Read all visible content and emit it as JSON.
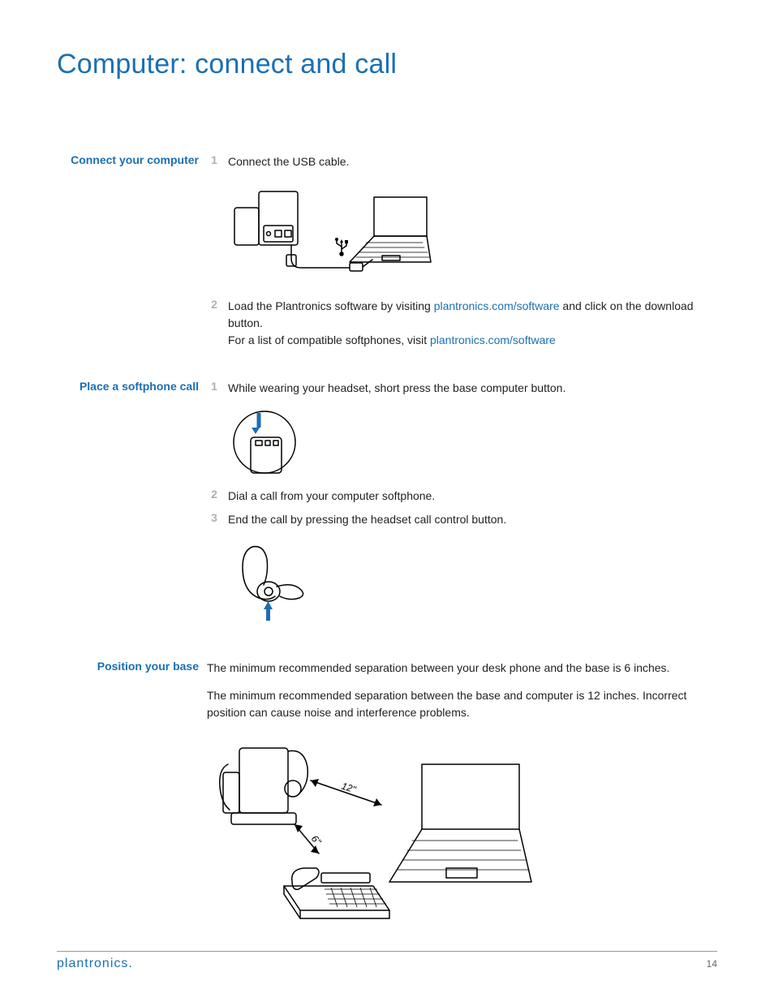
{
  "title": "Computer: connect and call",
  "sections": {
    "connect": {
      "label": "Connect your computer",
      "steps": [
        {
          "num": "1",
          "text": "Connect the USB cable."
        },
        {
          "num": "2",
          "pre": "Load the Plantronics software by visiting ",
          "link1": "plantronics.com/software",
          "mid": " and click on the download button.",
          "line2a": "For a list of compatible softphones, visit ",
          "link2": "plantronics.com/software"
        }
      ]
    },
    "softphone": {
      "label": "Place a softphone call",
      "steps": [
        {
          "num": "1",
          "text": "While wearing your headset, short press the base computer button."
        },
        {
          "num": "2",
          "text": "Dial a call from your computer softphone."
        },
        {
          "num": "3",
          "text": "End the call by pressing the headset call control button."
        }
      ]
    },
    "position": {
      "label": "Position your base",
      "para1": "The minimum recommended separation between your desk phone and the base is 6 inches.",
      "para2": "The minimum recommended separation between the base and computer is 12 inches. Incorrect position can cause noise and interference problems.",
      "dist12": "12\"",
      "dist6": "6\""
    }
  },
  "footer": {
    "logo": "plantronics.",
    "page": "14"
  }
}
